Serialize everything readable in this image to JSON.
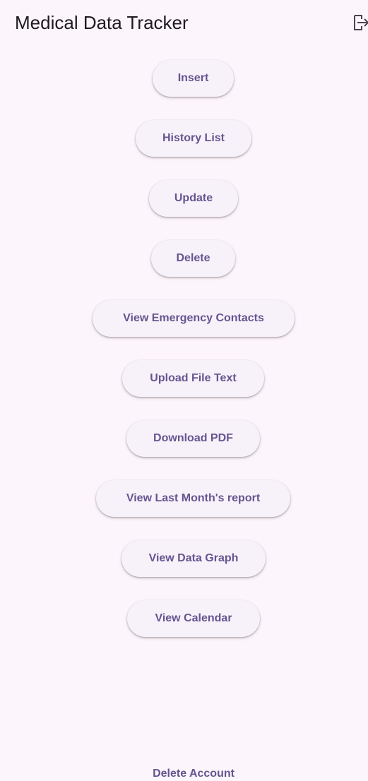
{
  "app_bar": {
    "title": "Medical Data Tracker",
    "logout_icon": "logout-icon"
  },
  "menu": {
    "buttons": [
      "Insert",
      "History List",
      "Update",
      "Delete",
      "View Emergency Contacts",
      "Upload File Text",
      "Download PDF",
      "View Last Month's report",
      "View Data Graph",
      "View Calendar"
    ]
  },
  "footer": {
    "delete_account_label": "Delete Account"
  },
  "colors": {
    "background": "#fcf5fb",
    "button_background": "#f7f2fa",
    "button_text": "#65558f",
    "title_text": "#1d1b20"
  }
}
